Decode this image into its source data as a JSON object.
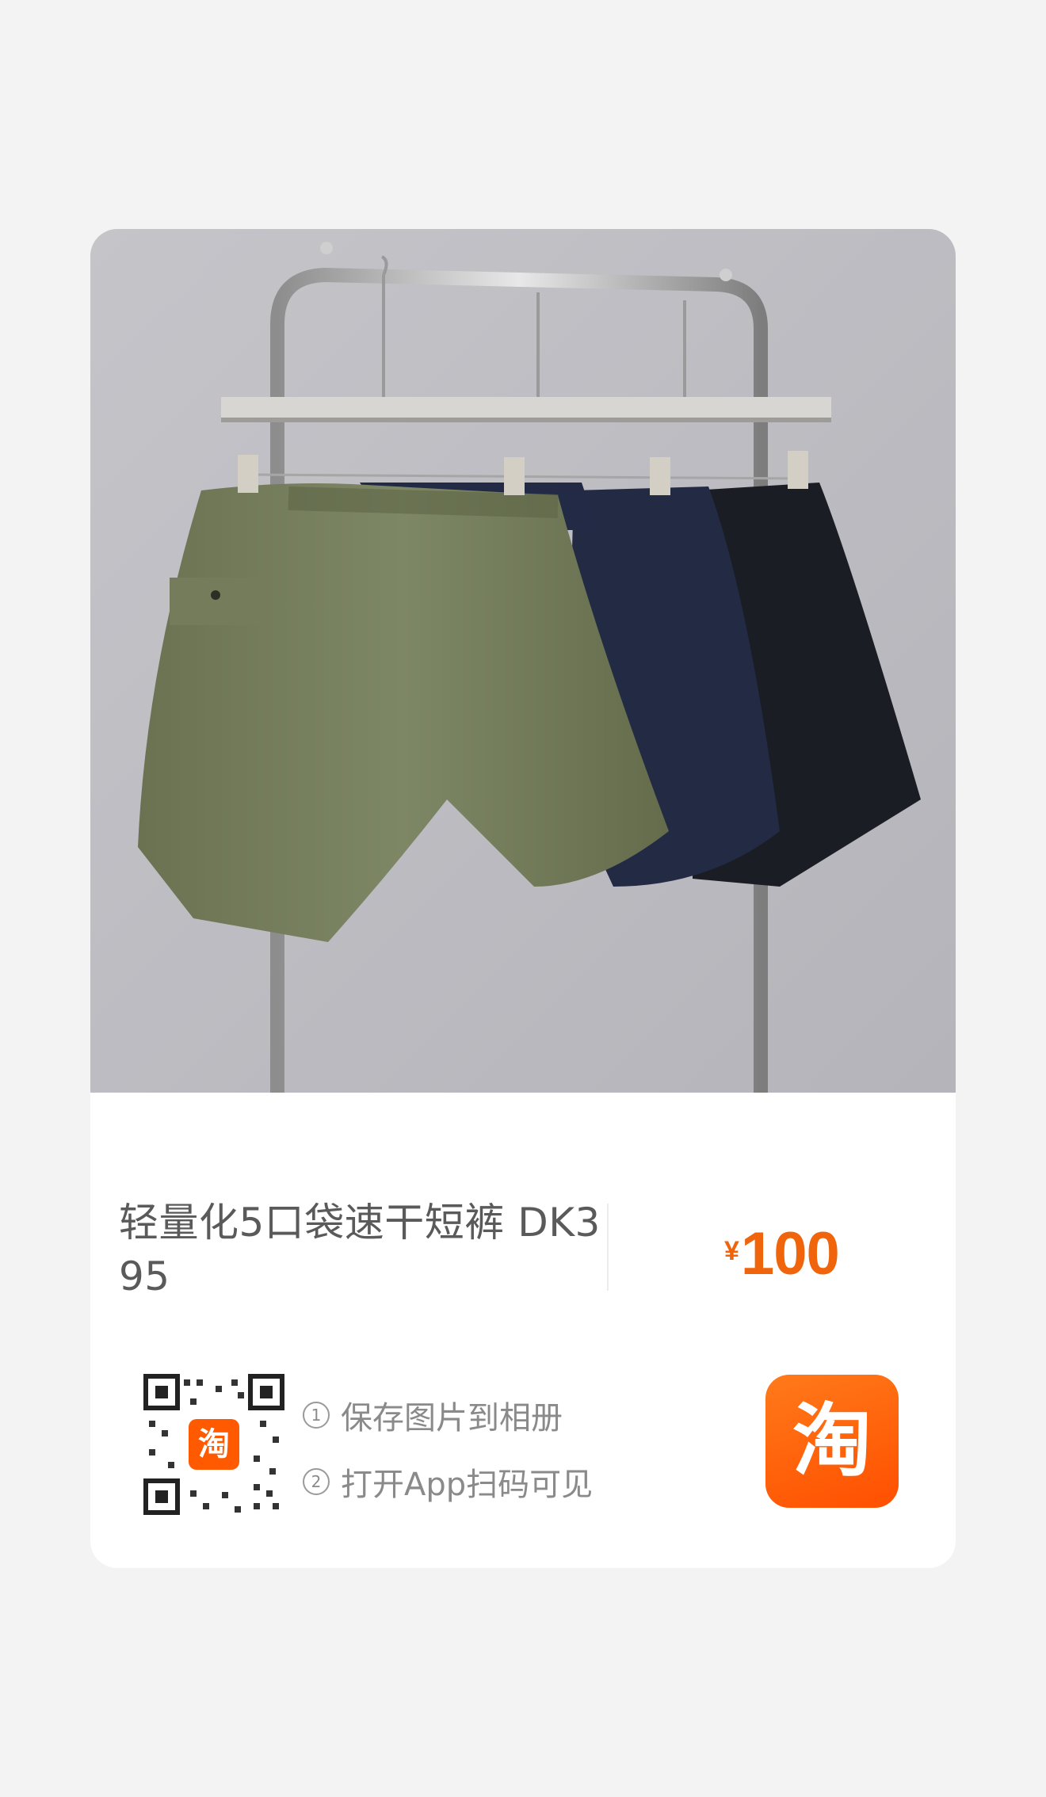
{
  "product": {
    "title": "轻量化5口袋速干短裤 DK395",
    "price_symbol": "¥",
    "price_amount": "100"
  },
  "qr": {
    "center_badge": "淘"
  },
  "instructions": {
    "step1_num": "1",
    "step1_text": "保存图片到相册",
    "step2_num": "2",
    "step2_text": "打开App扫码可见"
  },
  "app": {
    "logo_text": "淘"
  },
  "colors": {
    "accent": "#ff5000",
    "price": "#f0640c"
  },
  "icons": [
    "qr-code-icon",
    "taobao-logo-icon"
  ]
}
